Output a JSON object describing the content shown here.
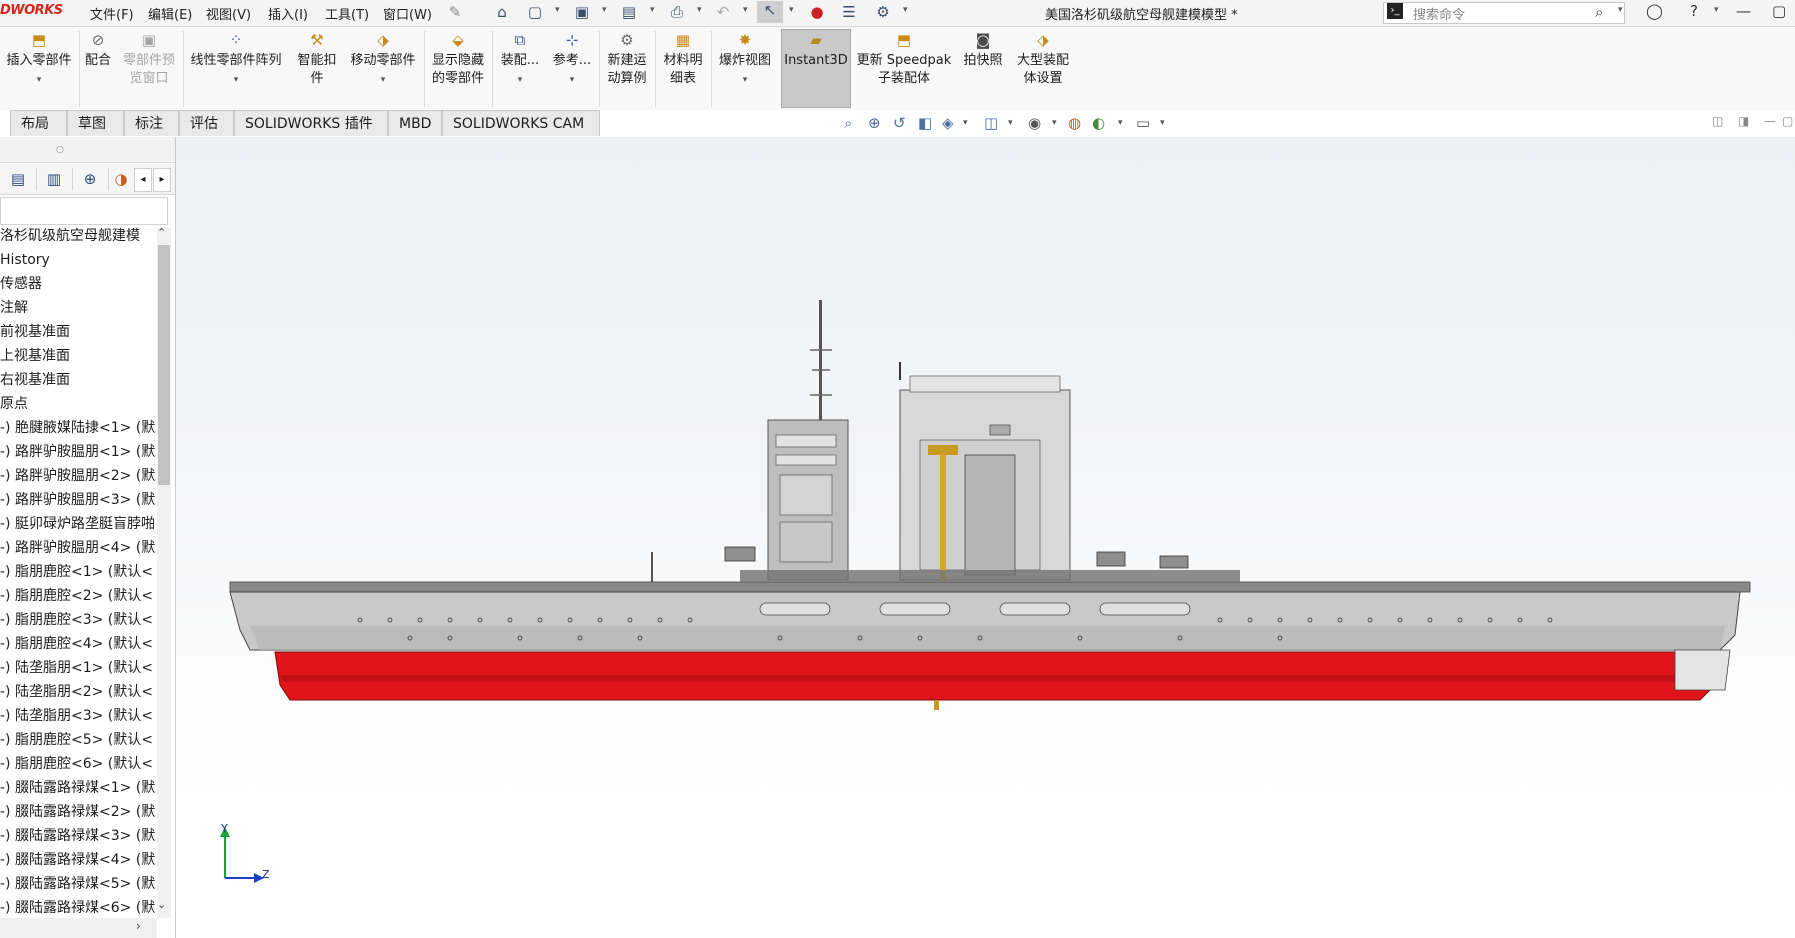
{
  "app": {
    "brand": "DWORKS",
    "document_title": "美国洛杉矶级航空母舰建模模型 *",
    "menu": [
      "文件(F)",
      "编辑(E)",
      "视图(V)",
      "插入(I)",
      "工具(T)",
      "窗口(W)"
    ],
    "search_placeholder": "搜索命令"
  },
  "ribbon": {
    "buttons": [
      {
        "line1": "插入零部件",
        "line2": "",
        "enabled": true,
        "icon": "insert-component-icon"
      },
      {
        "line1": "配合",
        "line2": "",
        "enabled": true,
        "icon": "mate-icon"
      },
      {
        "line1": "零部件预",
        "line2": "览窗口",
        "enabled": false,
        "icon": "preview-window-icon"
      },
      {
        "line1": "线性零部件阵列",
        "line2": "",
        "enabled": true,
        "icon": "linear-pattern-icon"
      },
      {
        "line1": "智能扣",
        "line2": "件",
        "enabled": true,
        "icon": "smart-fastener-icon"
      },
      {
        "line1": "移动零部件",
        "line2": "",
        "enabled": true,
        "icon": "move-component-icon"
      },
      {
        "line1": "显示隐藏",
        "line2": "的零部件",
        "enabled": true,
        "icon": "show-hidden-icon"
      },
      {
        "line1": "装配...",
        "line2": "",
        "enabled": true,
        "icon": "assembly-features-icon"
      },
      {
        "line1": "参考...",
        "line2": "",
        "enabled": true,
        "icon": "reference-geometry-icon"
      },
      {
        "line1": "新建运",
        "line2": "动算例",
        "enabled": true,
        "icon": "motion-study-icon"
      },
      {
        "line1": "材料明",
        "line2": "细表",
        "enabled": true,
        "icon": "bom-icon"
      },
      {
        "line1": "爆炸视图",
        "line2": "",
        "enabled": true,
        "icon": "exploded-view-icon"
      },
      {
        "line1": "Instant3D",
        "line2": "",
        "enabled": true,
        "icon": "instant3d-icon"
      },
      {
        "line1": "更新 Speedpak",
        "line2": "子装配体",
        "enabled": true,
        "icon": "speedpak-icon"
      },
      {
        "line1": "拍快照",
        "line2": "",
        "enabled": true,
        "icon": "snapshot-icon"
      },
      {
        "line1": "大型装配",
        "line2": "体设置",
        "enabled": true,
        "icon": "large-assembly-icon"
      }
    ]
  },
  "tabs": [
    "布局",
    "草图",
    "标注",
    "评估",
    "SOLIDWORKS 插件",
    "MBD",
    "SOLIDWORKS CAM"
  ],
  "feature_tree": {
    "items": [
      "洛杉矶级航空母舰建模",
      "History",
      "传感器",
      "注解",
      "前视基准面",
      "上视基准面",
      "右视基准面",
      "原点",
      "-) 脃腱腋媒陆捸<1> (默",
      "-) 路胖驴胺腽朋<1> (默",
      "-) 路胖驴胺腽朋<2> (默",
      "-) 路胖驴胺腽朋<3> (默",
      "-) 脡卯碌炉路垄脡盲脖啪",
      "-) 路胖驴胺腽朋<4> (默",
      "-) 脂朋鹿腔<1> (默认<",
      "-) 脂朋鹿腔<2> (默认<",
      "-) 脂朋鹿腔<3> (默认<",
      "-) 脂朋鹿腔<4> (默认<",
      "-) 陆垄脂朋<1> (默认<",
      "-) 陆垄脂朋<2> (默认<",
      "-) 陆垄脂朋<3> (默认<",
      "-) 脂朋鹿腔<5> (默认<",
      "-) 脂朋鹿腔<6> (默认<",
      "-) 腏陆露路禄煤<1> (默",
      "-) 腏陆露路禄煤<2> (默",
      "-) 腏陆露路禄煤<3> (默",
      "-) 腏陆露路禄煤<4> (默",
      "-) 腏陆露路禄煤<5> (默",
      "-) 腏陆露路禄煤<6> (默"
    ]
  },
  "triad": {
    "y": "Y",
    "z": "Z"
  },
  "colors": {
    "hull_red": "#e0141a",
    "hull_gray": "#c9c9c9",
    "ribbon_active": "#c9c9c9",
    "brand_red": "#d7261d"
  }
}
